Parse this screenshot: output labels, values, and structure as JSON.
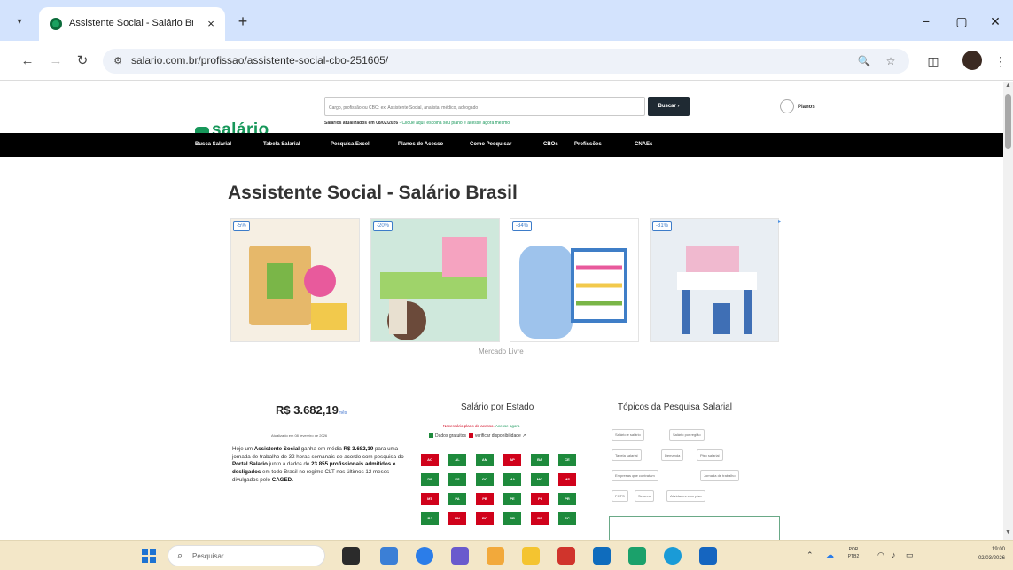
{
  "browser": {
    "tab_title": "Assistente Social - Salário Brasil",
    "tab_close": "×",
    "new_tab": "+",
    "url": "salario.com.br/profissao/assistente-social-cbo-251605/",
    "window": {
      "minimize": "−",
      "maximize": "▢",
      "close": "✕"
    }
  },
  "site": {
    "logo": "salário",
    "search_placeholder": "Cargo, profissão ou CBO: ex. Assistente Social, analista, médico, advogado",
    "search_button": "Buscar ›",
    "update_bold": "Salários atualizados em 08/02/2026",
    "update_link": "- Clique aqui, escolha seu plano e acesse agora mesmo",
    "premium_label": "Planos"
  },
  "menu": [
    "Busca Salarial",
    "Tabela Salarial",
    "Pesquisa Excel",
    "Planos de Acesso",
    "Como Pesquisar",
    "CBOs",
    "Profissões",
    "CNAEs"
  ],
  "page": {
    "title": "Assistente Social - Salário Brasil",
    "ad_label": "Mercado Livre",
    "ads": [
      {
        "discount": "-5%",
        "colors": [
          "#f3d9b0",
          "#7ab648",
          "#e85a9c"
        ]
      },
      {
        "discount": "-20%",
        "colors": [
          "#b8e0d2",
          "#f5a3c0",
          "#9fd36a"
        ]
      },
      {
        "discount": "-34%",
        "colors": [
          "#9ec3ec",
          "#f2c94c",
          "#5a9fe0"
        ]
      },
      {
        "discount": "-31%",
        "colors": [
          "#d9e6f2",
          "#3f6fb5",
          "#f0b9cf"
        ]
      }
    ]
  },
  "salary": {
    "value": "R$ 3.682,19",
    "unit": "mês",
    "date": "Atualizado em 08 fevereiro de 2026",
    "text_intro": "Hoje um ",
    "role": "Assistente Social",
    "text_mid": " ganha em média ",
    "value_inline": "R$ 3.682,19",
    "text_hours": " para uma jornada de trabalho de 32 horas semanais de acordo com pesquisa do ",
    "source": "Portal Salario",
    "text_data": " junto a dados de ",
    "count": "23.855 profissionais admitidos e desligados",
    "text_end": " em todo Brasil no regime CLT nos últimos 12 meses divulgados pelo ",
    "caged": "CAGED."
  },
  "states": {
    "title": "Salário por Estado",
    "note_red": "Necessário plano de acesso.",
    "note_green": "Acesse agora",
    "legend_green": "Dados gratuitos",
    "legend_red": "verificar disponibilidade",
    "cells": [
      {
        "uf": "AC",
        "status": "red"
      },
      {
        "uf": "AL",
        "status": "green"
      },
      {
        "uf": "AM",
        "status": "green"
      },
      {
        "uf": "AP",
        "status": "red"
      },
      {
        "uf": "BA",
        "status": "green"
      },
      {
        "uf": "CE",
        "status": "green"
      },
      {
        "uf": "DF",
        "status": "green"
      },
      {
        "uf": "ES",
        "status": "green"
      },
      {
        "uf": "GO",
        "status": "green"
      },
      {
        "uf": "MA",
        "status": "green"
      },
      {
        "uf": "MG",
        "status": "green"
      },
      {
        "uf": "MS",
        "status": "red"
      },
      {
        "uf": "MT",
        "status": "red"
      },
      {
        "uf": "PA",
        "status": "green"
      },
      {
        "uf": "PB",
        "status": "red"
      },
      {
        "uf": "PE",
        "status": "green"
      },
      {
        "uf": "PI",
        "status": "red"
      },
      {
        "uf": "PR",
        "status": "green"
      },
      {
        "uf": "RJ",
        "status": "green"
      },
      {
        "uf": "RN",
        "status": "red"
      },
      {
        "uf": "RO",
        "status": "red"
      },
      {
        "uf": "RR",
        "status": "green"
      },
      {
        "uf": "RS",
        "status": "red"
      },
      {
        "uf": "SC",
        "status": "green"
      }
    ],
    "colors": {
      "green": "#1e8a3c",
      "red": "#d0021b"
    }
  },
  "topics": {
    "title": "Tópicos da Pesquisa Salarial",
    "tags": [
      "Salário e salário",
      "Salário por região",
      "Tabela salarial",
      "Demanda",
      "Piso salarial",
      "Empresas que contratam",
      "Jornada de trabalho",
      "FGTS",
      "Setores",
      "Atividades com piso"
    ]
  },
  "taskbar": {
    "search": "Pesquisar",
    "lang_1": "POR",
    "lang_2": "PTB2",
    "time": "19:00",
    "date": "02/03/2026"
  }
}
